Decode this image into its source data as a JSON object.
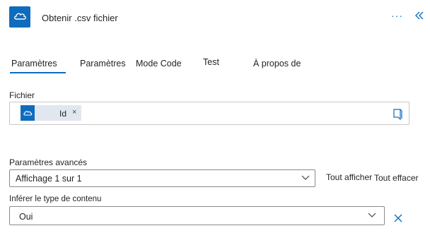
{
  "header": {
    "title": "Obtenir .csv fichier",
    "more_label": "···",
    "icon": "onedrive-cloud-icon",
    "accent": "#0f6cbd"
  },
  "tabs": [
    {
      "label": "Paramètres",
      "active": true
    },
    {
      "label": "Paramètres",
      "active": false
    },
    {
      "label": "Mode Code",
      "active": false
    },
    {
      "label": "Test",
      "active": false
    },
    {
      "label": "À propos de",
      "active": false
    }
  ],
  "file": {
    "label": "Fichier",
    "token_label": "Id",
    "token_remove": "×"
  },
  "advanced": {
    "label": "Paramètres avancés",
    "select_value": "Affichage 1 sur 1",
    "show_all": "Tout afficher",
    "clear_all": "Tout effacer"
  },
  "infer": {
    "label": "Inférer le type de contenu",
    "select_value": "Oui"
  }
}
